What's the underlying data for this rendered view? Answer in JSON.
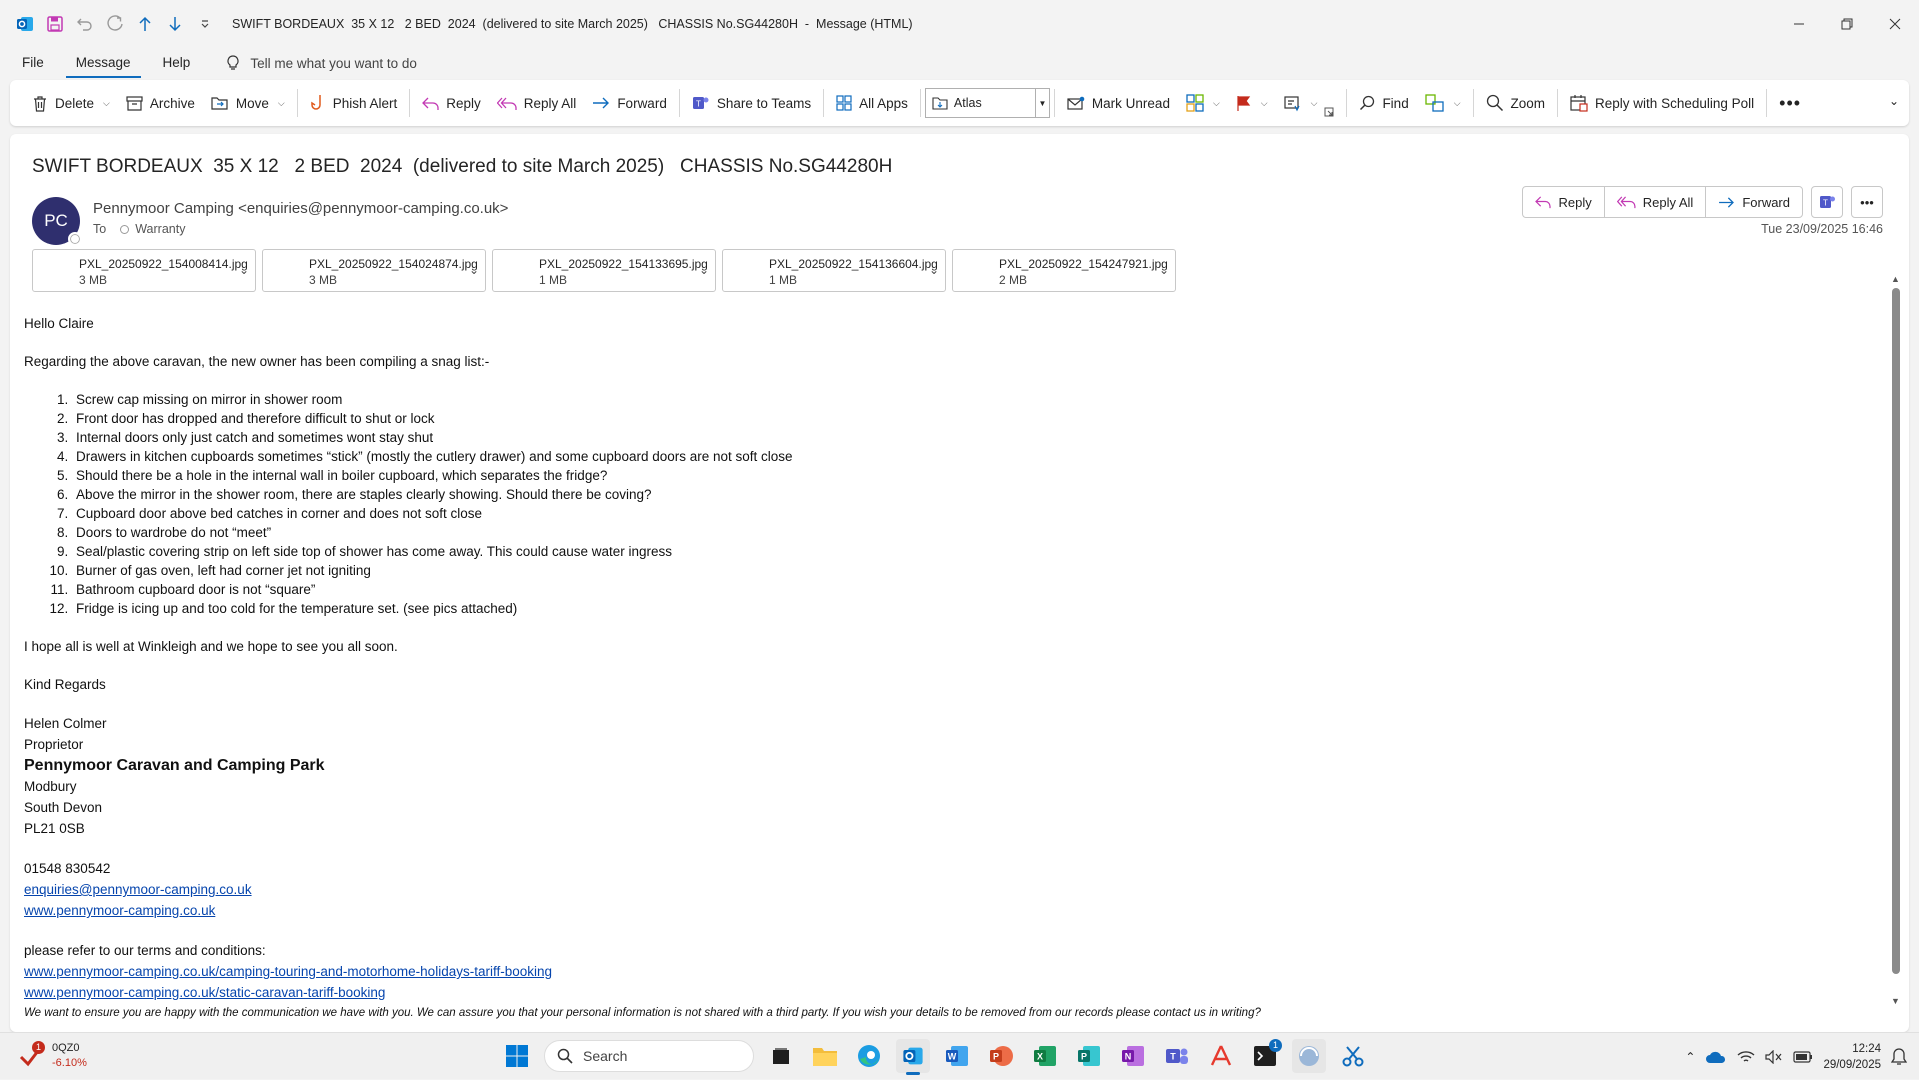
{
  "window": {
    "title": "SWIFT BORDEAUX  35 X 12   2 BED  2024  (delivered to site March 2025)   CHASSIS No.SG44280H  -  Message (HTML)"
  },
  "menu": {
    "file": "File",
    "message": "Message",
    "help": "Help",
    "tell": "Tell me what you want to do"
  },
  "ribbon": {
    "delete": "Delete",
    "archive": "Archive",
    "move": "Move",
    "phish": "Phish Alert",
    "reply": "Reply",
    "reply_all": "Reply All",
    "forward": "Forward",
    "share_teams": "Share to Teams",
    "all_apps": "All Apps",
    "atlas": "Atlas",
    "mark_unread": "Mark Unread",
    "find": "Find",
    "zoom": "Zoom",
    "scheduling": "Reply with Scheduling Poll"
  },
  "email": {
    "subject": "SWIFT BORDEAUX  35 X 12   2 BED  2024  (delivered to site March 2025)   CHASSIS No.SG44280H",
    "avatar": "PC",
    "sender": "Pennymoor Camping <enquiries@pennymoor-camping.co.uk>",
    "to_label": "To",
    "to": "Warranty",
    "date": "Tue 23/09/2025 16:46",
    "reply": "Reply",
    "reply_all": "Reply All",
    "forward": "Forward",
    "attachments": [
      {
        "name": "PXL_20250922_154008414.jpg",
        "size": "3 MB"
      },
      {
        "name": "PXL_20250922_154024874.jpg",
        "size": "3 MB"
      },
      {
        "name": "PXL_20250922_154133695.jpg",
        "size": "1 MB"
      },
      {
        "name": "PXL_20250922_154136604.jpg",
        "size": "1 MB"
      },
      {
        "name": "PXL_20250922_154247921.jpg",
        "size": "2 MB"
      }
    ],
    "greeting": "Hello Claire",
    "intro": "Regarding the above caravan,  the new owner has been compiling a snag list:-",
    "snags": [
      "Screw cap missing on mirror in shower room",
      "Front door has dropped and therefore difficult to shut or lock",
      "Internal doors only just catch and sometimes wont stay shut",
      "Drawers in kitchen cupboards sometimes “stick” (mostly the cutlery drawer) and some cupboard doors are not soft close",
      "Should there be a hole in the internal wall in boiler cupboard, which separates the fridge?",
      "Above the mirror in the shower room, there are staples clearly showing. Should there be coving?",
      "Cupboard door above bed catches in corner and does not soft close",
      "Doors to wardrobe do not “meet”",
      "Seal/plastic covering strip on left side top of shower has come away. This could cause water ingress",
      "Burner of gas oven, left had corner jet not igniting",
      "Bathroom cupboard door is not “square”",
      "Fridge is icing up and too cold for the temperature set. (see pics attached)"
    ],
    "closing": "I hope all is well at Winkleigh and we hope to see you all soon.",
    "regards": "Kind Regards",
    "sig_name": "Helen Colmer",
    "sig_role": "Proprietor",
    "sig_company": "Pennymoor Caravan and Camping Park",
    "sig_addr1": "Modbury",
    "sig_addr2": "South Devon",
    "sig_postcode": "PL21 0SB",
    "sig_phone": "01548 830542",
    "sig_email": "enquiries@pennymoor-camping.co.uk",
    "sig_web": "www.pennymoor-camping.co.uk",
    "terms_intro": "please refer to our terms and conditions:",
    "terms_link1": "www.pennymoor-camping.co.uk/camping-touring-and-motorhome-holidays-tariff-booking",
    "terms_link2": "www.pennymoor-camping.co.uk/static-caravan-tariff-booking",
    "disclaimer": "We want to ensure you are happy with the communication we have with you.  We can assure you that your personal information is not shared with a third party. If you wish your details to be removed from our records please contact us in writing?"
  },
  "taskbar": {
    "stock_badge": "1",
    "stock_name": "0QZ0",
    "stock_change": "-6.10%",
    "search": "Search",
    "teams_badge": "1",
    "time": "12:24",
    "date": "29/09/2025"
  },
  "colors": {
    "accent": "#0f6cbd",
    "avatar": "#2f2f6e",
    "link": "#0645ad",
    "negative": "#c42b1c"
  }
}
